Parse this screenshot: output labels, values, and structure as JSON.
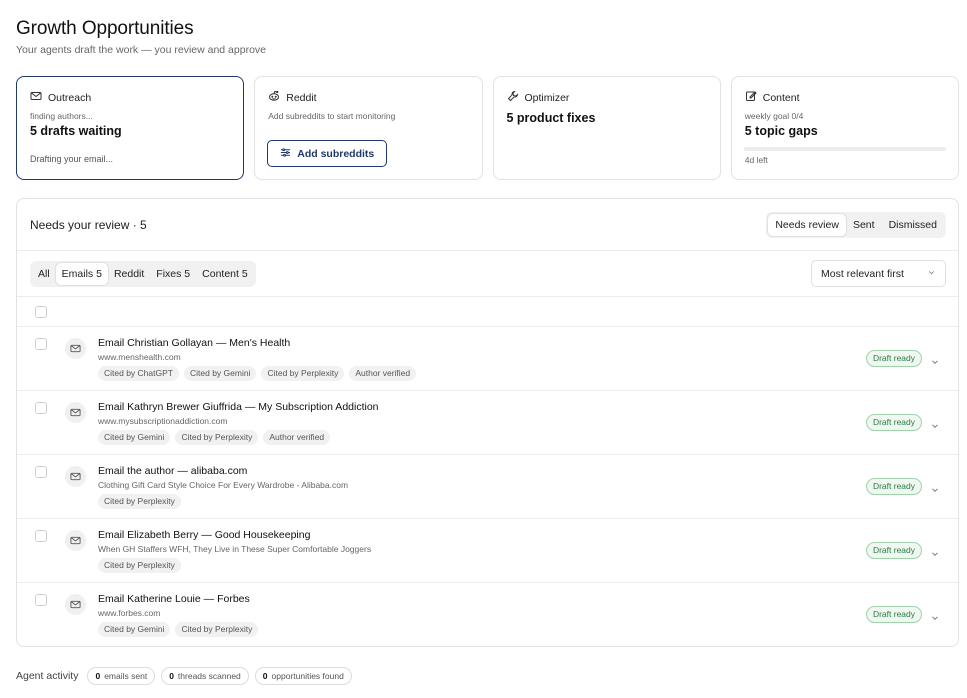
{
  "header": {
    "title": "Growth Opportunities",
    "subtitle": "Your agents draft the work — you review and approve"
  },
  "cards": {
    "outreach": {
      "title": "Outreach",
      "status": "finding authors...",
      "metric": "5 drafts waiting",
      "footer": "Drafting your email..."
    },
    "reddit": {
      "title": "Reddit",
      "status": "Add subreddits to start monitoring",
      "button": "Add subreddits"
    },
    "optimizer": {
      "title": "Optimizer",
      "metric": "5 product fixes"
    },
    "content": {
      "title": "Content",
      "status": "weekly goal 0/4",
      "metric": "5 topic gaps",
      "footer": "4d left",
      "progress": 0
    }
  },
  "review": {
    "title": "Needs your review · 5",
    "views": [
      "Needs review",
      "Sent",
      "Dismissed"
    ],
    "active_view": "Needs review",
    "tabs": [
      "All",
      "Emails 5",
      "Reddit",
      "Fixes 5",
      "Content 5"
    ],
    "active_tab": "Emails 5",
    "sort": "Most relevant first"
  },
  "items": [
    {
      "title": "Email Christian Gollayan — Men's Health",
      "subtitle": "www.menshealth.com",
      "tags": [
        "Cited by ChatGPT",
        "Cited by Gemini",
        "Cited by Perplexity",
        "Author verified"
      ],
      "status": "Draft ready"
    },
    {
      "title": "Email Kathryn Brewer Giuffrida — My Subscription Addiction",
      "subtitle": "www.mysubscriptionaddiction.com",
      "tags": [
        "Cited by Gemini",
        "Cited by Perplexity",
        "Author verified"
      ],
      "status": "Draft ready"
    },
    {
      "title": "Email the author — alibaba.com",
      "subtitle": "Clothing Gift Card Style Choice For Every Wardrobe - Alibaba.com",
      "tags": [
        "Cited by Perplexity"
      ],
      "status": "Draft ready"
    },
    {
      "title": "Email Elizabeth Berry — Good Housekeeping",
      "subtitle": "When GH Staffers WFH, They Live in These Super Comfortable Joggers",
      "tags": [
        "Cited by Perplexity"
      ],
      "status": "Draft ready"
    },
    {
      "title": "Email Katherine Louie — Forbes",
      "subtitle": "www.forbes.com",
      "tags": [
        "Cited by Gemini",
        "Cited by Perplexity"
      ],
      "status": "Draft ready"
    }
  ],
  "activity": {
    "label": "Agent activity",
    "stats": [
      {
        "value": "0",
        "label": "emails sent"
      },
      {
        "value": "0",
        "label": "threads scanned"
      },
      {
        "value": "0",
        "label": "opportunities found"
      }
    ]
  },
  "colors": {
    "accent": "#1f3a68",
    "success": "#2e7a45",
    "success_bg": "#eef8f0"
  },
  "icons": {
    "outreach": "mail-icon",
    "reddit": "reddit-icon",
    "optimizer": "wrench-icon",
    "content": "edit-icon",
    "row": "mail-icon"
  }
}
